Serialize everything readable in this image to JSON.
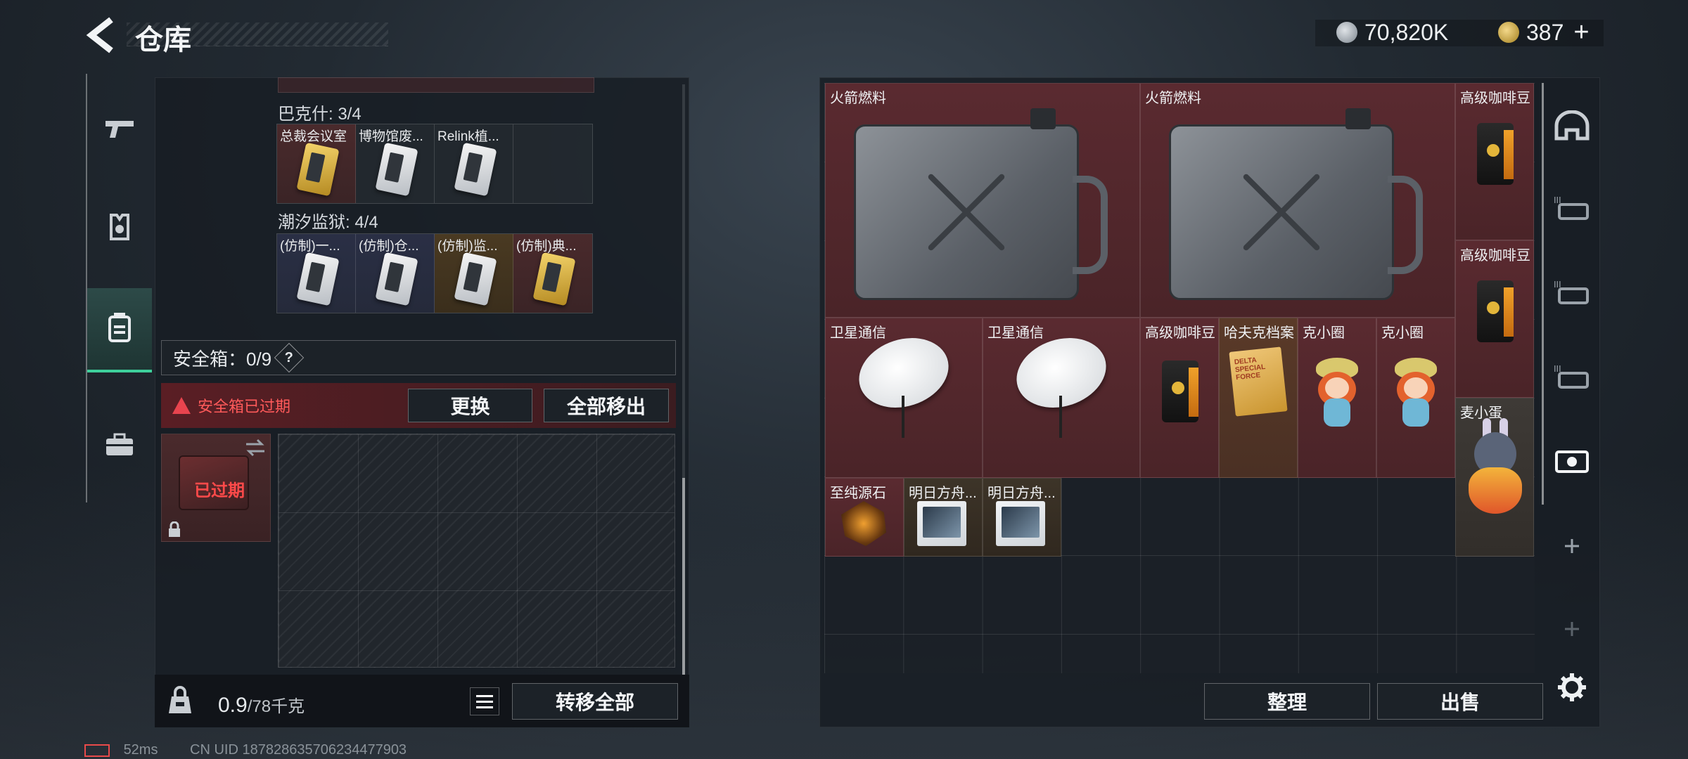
{
  "header": {
    "title": "仓库",
    "currency_silver": "70,820K",
    "currency_gold": "387",
    "plus": "+"
  },
  "left": {
    "groups": [
      {
        "label": "巴克什: 3/4",
        "items": [
          {
            "name": "总裁会议室",
            "style": "red",
            "card": "gold"
          },
          {
            "name": "博物馆废...",
            "style": "",
            "card": "white"
          },
          {
            "name": "Relink植...",
            "style": "",
            "card": "white"
          }
        ]
      },
      {
        "label": "潮汐监狱: 4/4",
        "items": [
          {
            "name": "(仿制)一...",
            "style": "blue",
            "card": "white"
          },
          {
            "name": "(仿制)仓...",
            "style": "blue",
            "card": "white"
          },
          {
            "name": "(仿制)监...",
            "style": "gold",
            "card": "white"
          },
          {
            "name": "(仿制)典...",
            "style": "red",
            "card": "gold"
          }
        ]
      }
    ],
    "safebox_label": "安全箱：0/9",
    "question": "?",
    "expired_notice": "安全箱已过期",
    "replace_button": "更换",
    "remove_all_button": "全部移出",
    "safebox_status": "已过期",
    "weight_value": "0.9",
    "weight_max": "/78千克",
    "transfer_all_button": "转移全部"
  },
  "right": {
    "items": [
      "火箭燃料",
      "火箭燃料",
      "高级咖啡豆",
      "高级咖啡豆",
      "卫星通信",
      "卫星通信",
      "高级咖啡豆",
      "哈夫克档案",
      "克小圈",
      "克小圈",
      "麦小蛋",
      "至纯源石",
      "明日方舟...",
      "明日方舟..."
    ],
    "folder_text": "DELTA SPECIAL FORCE",
    "sort_button": "整理",
    "sell_button": "出售"
  },
  "status_bar": {
    "ping": "52ms",
    "uid": "CN UID 187828635706234477903"
  },
  "colors": {
    "accent_green": "#3ecf9b",
    "warning_red": "#ff5a5a",
    "item_red_bg": "#5a2a30"
  },
  "icons": [
    "back-arrow-icon",
    "silver-coin-icon",
    "gold-coin-icon",
    "gun-icon",
    "armor-icon",
    "backpack-icon",
    "briefcase-icon",
    "question-icon",
    "warning-icon",
    "swap-icon",
    "lock-icon",
    "weight-bag-icon",
    "list-icon",
    "helmet-icon",
    "gear-icon",
    "plus-icon"
  ]
}
